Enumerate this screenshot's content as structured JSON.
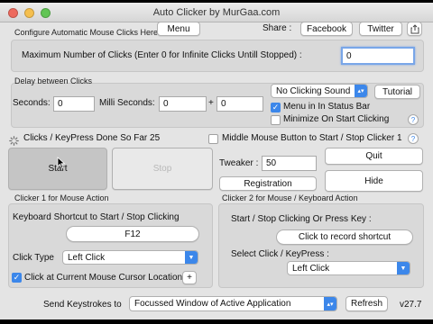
{
  "window": {
    "title": "Auto Clicker by MurGaa.com"
  },
  "header": {
    "configure_label": "Configure Automatic Mouse Clicks Here",
    "menu_button": "Menu",
    "share_label": "Share :",
    "facebook_button": "Facebook",
    "twitter_button": "Twitter"
  },
  "max_clicks": {
    "label": "Maximum Number of Clicks (Enter 0 for Infinite Clicks Untill Stopped) :",
    "value": "0"
  },
  "delay": {
    "label": "Delay between Clicks",
    "seconds_label": "Seconds:",
    "seconds_value": "0",
    "milli_label": "Milli Seconds:",
    "milli_value": "0",
    "plus": "+",
    "extra_value": "0"
  },
  "sound": {
    "selected": "No Clicking Sound",
    "tutorial_button": "Tutorial"
  },
  "options": {
    "menu_in_status_bar": "Menu in In Status Bar",
    "minimize_on_start": "Minimize On Start Clicking",
    "help": "?"
  },
  "status": {
    "clicks_done": "Clicks / KeyPress Done So Far 25"
  },
  "middle_mouse": {
    "label": "Middle Mouse Button to Start / Stop Clicker 1",
    "help": "?"
  },
  "controls": {
    "start": "Start",
    "stop": "Stop",
    "tweaker_label": "Tweaker :",
    "tweaker_value": "50",
    "registration": "Registration",
    "quit": "Quit",
    "hide": "Hide"
  },
  "clicker1": {
    "title": "Clicker 1 for Mouse Action",
    "shortcut_label": "Keyboard Shortcut to Start / Stop Clicking",
    "shortcut_value": "F12",
    "click_type_label": "Click Type",
    "click_type_value": "Left Click",
    "cursor_location_label": "Click at Current Mouse Cursor Location",
    "add": "+"
  },
  "clicker2": {
    "title": "Clicker 2 for Mouse / Keyboard Action",
    "start_stop_label": "Start / Stop Clicking Or Press Key :",
    "record_button": "Click to record shortcut",
    "select_label": "Select Click / KeyPress :",
    "select_value": "Left Click"
  },
  "footer": {
    "send_label": "Send Keystrokes to",
    "target_value": "Focussed Window of Active Application",
    "refresh_button": "Refresh",
    "version": "v27.7"
  },
  "colors": {
    "accent": "#3c87ea",
    "focus_ring": "#79a6e8",
    "red": "#ed6a5e",
    "yellow": "#f5bf4f",
    "green": "#61c554"
  },
  "icons": [
    "close-icon",
    "minimize-icon",
    "zoom-icon",
    "share-icon",
    "spinner-icon",
    "chevron-updown-icon",
    "cursor-icon"
  ]
}
